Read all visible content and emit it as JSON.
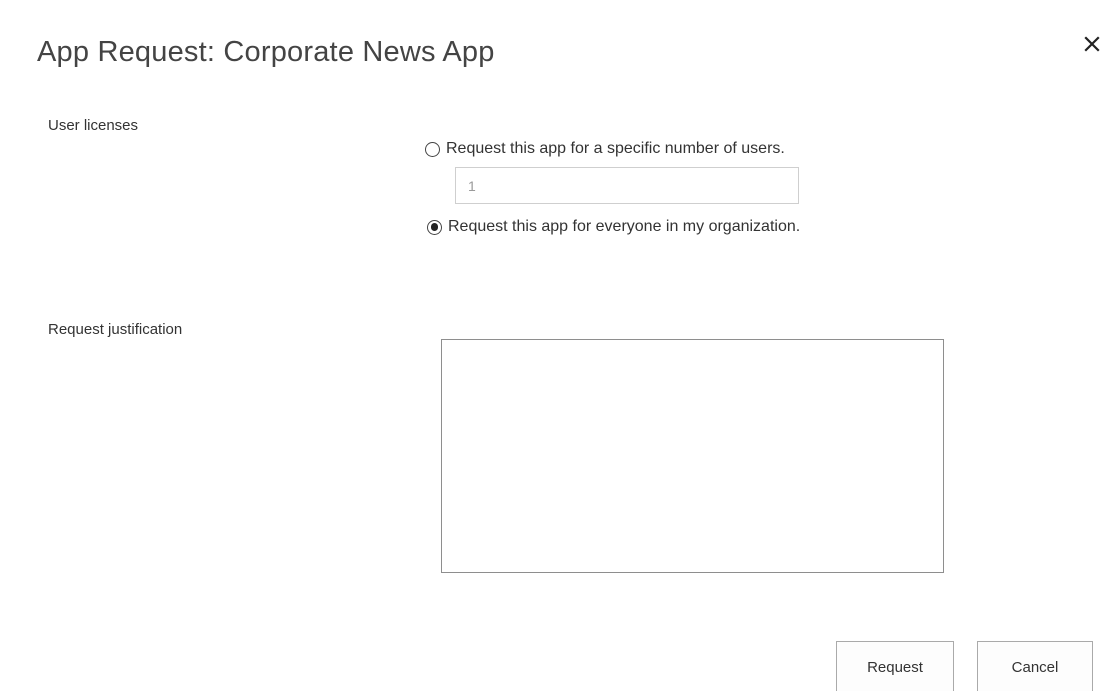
{
  "dialog": {
    "title": "App Request: Corporate News App",
    "close_icon": "close-icon"
  },
  "user_licenses": {
    "label": "User licenses",
    "options": [
      {
        "label": "Request this app for a specific number of users.",
        "selected": false
      },
      {
        "label": "Request this app for everyone in my organization.",
        "selected": true
      }
    ],
    "number_of_users": "1"
  },
  "justification": {
    "label": "Request justification",
    "value": ""
  },
  "buttons": {
    "request_label": "Request",
    "cancel_label": "Cancel"
  }
}
